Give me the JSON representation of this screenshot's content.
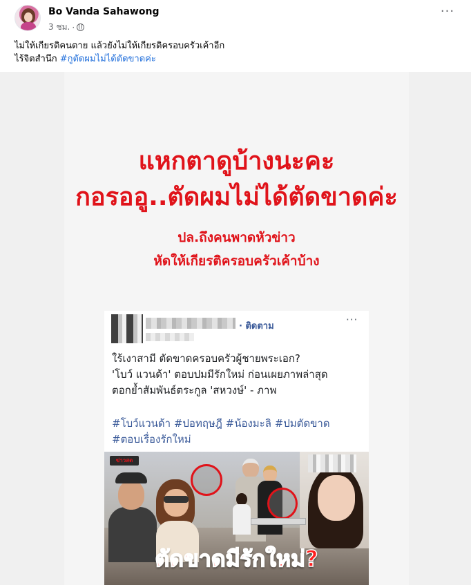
{
  "post": {
    "author": "Bo Vanda Sahawong",
    "timestamp": "3 ชม.",
    "separator": "·",
    "more_label": "···",
    "caption_line1": "ไม่ให้เกียรติคนตาย แล้วยังไม่ให้เกียรติครอบครัวเค้าอีก",
    "caption_line2_text": "ไร้จิตสำนึก ",
    "caption_hashtag": "#กูตัดผมไม่ได้ตัดขาดค่ะ"
  },
  "graphic": {
    "headline_line1": "แหกตาดูบ้างนะคะ",
    "headline_line2": "กอรออู..ตัดผมไม่ได้ตัดขาดค่ะ",
    "subhead_line1": "ปล.ถึงคนพาดหัวข่าว",
    "subhead_line2": "หัดให้เกียรติครอบครัวเค้าบ้าง",
    "headline_color": "#e0131a"
  },
  "embed": {
    "follow_label": "· ติดตาม",
    "more_label": "···",
    "text_line1": "ใร้เงาสามี ตัดขาดครอบครัวผู้ชายพระเอก?",
    "text_line2": "'โบว์ แวนด้า' ตอบปมมีรักใหม่ ก่อนเผยภาพล่าสุด",
    "text_line3": "ตอกย้ำสัมพันธ์ตระกูล 'สหวงษ์' - ภาพ",
    "tags_line1": "#โบว์แวนด้า #ปอทฤษฎี #น้องมะลิ #ปมตัดขาด",
    "tags_line2": "#ตอบเรื่องรักใหม่",
    "image_overlay": "ตัดขาดมีรักใหม่?",
    "brand_tag": "ข่าวสด",
    "link_color": "#385898"
  }
}
